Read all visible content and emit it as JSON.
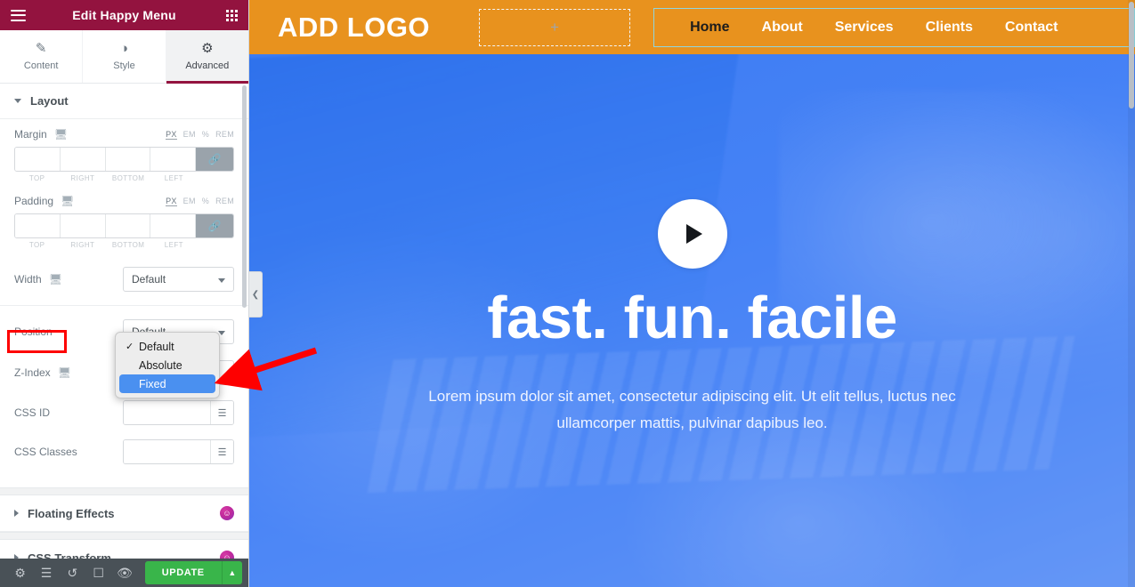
{
  "panel": {
    "header": {
      "title": "Edit Happy Menu",
      "menu_icon": "hamburger-icon",
      "apps_icon": "grid-apps-icon",
      "bg_color": "#93133f"
    },
    "tabs": [
      {
        "label": "Content",
        "icon": "pencil-icon",
        "active": false
      },
      {
        "label": "Style",
        "icon": "half-circle-icon",
        "active": false
      },
      {
        "label": "Advanced",
        "icon": "gear-icon",
        "active": true
      }
    ],
    "sections": {
      "layout": {
        "title": "Layout",
        "expanded": true
      },
      "floating_effects": {
        "title": "Floating Effects",
        "expanded": false,
        "pro": true
      },
      "css_transform": {
        "title": "CSS Transform",
        "expanded": false,
        "pro": true
      }
    },
    "controls": {
      "margin": {
        "label": "Margin",
        "units": [
          "PX",
          "EM",
          "%",
          "REM"
        ],
        "active_unit": "PX",
        "values": {
          "top": "",
          "right": "",
          "bottom": "",
          "left": ""
        },
        "captions": [
          "TOP",
          "RIGHT",
          "BOTTOM",
          "LEFT"
        ],
        "link_icon": "link-icon"
      },
      "padding": {
        "label": "Padding",
        "units": [
          "PX",
          "EM",
          "%",
          "REM"
        ],
        "active_unit": "PX",
        "values": {
          "top": "",
          "right": "",
          "bottom": "",
          "left": ""
        },
        "captions": [
          "TOP",
          "RIGHT",
          "BOTTOM",
          "LEFT"
        ],
        "link_icon": "link-icon"
      },
      "width": {
        "label": "Width",
        "value": "Default"
      },
      "position": {
        "label": "Position",
        "value": "Default",
        "highlighted": true
      },
      "z_index": {
        "label": "Z-Index",
        "value": ""
      },
      "css_id": {
        "label": "CSS ID",
        "value": "",
        "placeholder": "",
        "button_icon": "dynamic-tags-icon"
      },
      "css_classes": {
        "label": "CSS Classes",
        "value": "",
        "placeholder": "",
        "button_icon": "dynamic-tags-icon"
      }
    },
    "position_dropdown": {
      "open": true,
      "options": [
        {
          "label": "Default",
          "checked": true,
          "selected": false
        },
        {
          "label": "Absolute",
          "checked": false,
          "selected": false
        },
        {
          "label": "Fixed",
          "checked": false,
          "selected": true
        }
      ]
    },
    "footer": {
      "icons": [
        "settings-gear-icon",
        "navigator-layers-icon",
        "history-icon",
        "responsive-mode-icon",
        "preview-eye-icon"
      ],
      "update_label": "UPDATE",
      "update_color": "#39b54a",
      "caret_icon": "caret-up-icon"
    },
    "collapse_handle_icon": "chevron-left-icon"
  },
  "annotations": {
    "highlight_color": "#fe0000",
    "box_target": "position-label",
    "arrow_target": "dropdown-option-fixed"
  },
  "canvas": {
    "site_header": {
      "logo": "ADD LOGO",
      "bg_color": "#e8921e",
      "add_placeholder_icon": "plus-icon",
      "nav": [
        {
          "label": "Home",
          "active": true
        },
        {
          "label": "About",
          "active": false
        },
        {
          "label": "Services",
          "active": false
        },
        {
          "label": "Clients",
          "active": false
        },
        {
          "label": "Contact",
          "active": false
        }
      ]
    },
    "hero": {
      "play_icon": "play-triangle-icon",
      "title": "fast. fun. facile",
      "subtitle": "Lorem ipsum dolor sit amet, consectetur adipiscing elit. Ut elit tellus, luctus nec ullamcorper mattis, pulvinar dapibus leo.",
      "overlay_color": "#4a86f7"
    }
  }
}
